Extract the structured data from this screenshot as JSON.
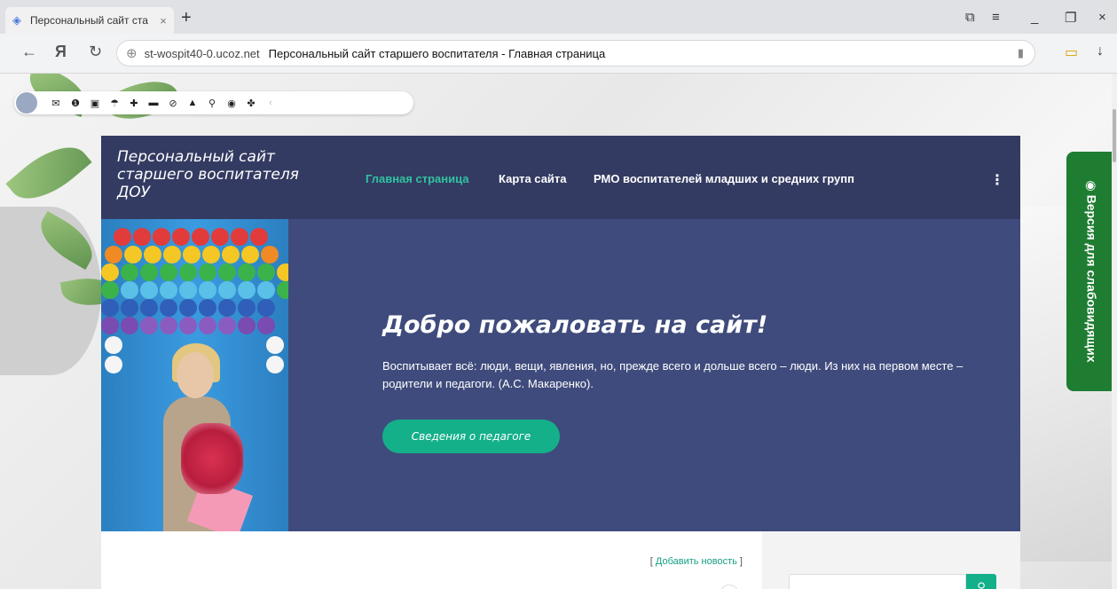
{
  "browser": {
    "tab_title": "Персональный сайт ста",
    "tab_close": "×",
    "new_tab": "+",
    "url_host": "st-wospit40-0.ucoz.net",
    "page_title": "Персональный сайт старшего воспитателя - Главная страница",
    "icons": {
      "favicon": "◈",
      "back": "←",
      "yandex": "Я",
      "reload": "↻",
      "globe": "⊕",
      "bookmark": "▮",
      "battery": "▭",
      "download": "↓",
      "tabs_list": "⧉",
      "menu": "≡",
      "minimize": "_",
      "restore": "❐",
      "close": "×"
    }
  },
  "ucoz_bar": {
    "icons": [
      "✉",
      "❶",
      "▣",
      "☂",
      "✚",
      "▬",
      "⊘",
      "▲",
      "⚲",
      "◉",
      "✤",
      "‹"
    ]
  },
  "site": {
    "logo": "Персональный сайт старшего воспитателя ДОУ",
    "menu": {
      "home": "Главная страница",
      "sitemap": "Карта сайта",
      "rmo": "РМО воспитателей младших и средних групп",
      "more": "⋮"
    },
    "hero": {
      "title": "Добро пожаловать на сайт!",
      "quote": "Воспитывает всё: люди, вещи, явления, но, прежде всего и дольше всего – люди. Из них на первом месте – родители и педагоги. (А.С. Макаренко).",
      "button": "Сведения о педагоге"
    },
    "content": {
      "add_news_open": "[ ",
      "add_news": "Добавить новость",
      "add_news_close": " ]"
    },
    "search_icon": "⚲"
  },
  "accessibility": {
    "label": "Версия для слабовидящих",
    "icon": "◉"
  },
  "colors": {
    "header_bg": "#343b62",
    "hero_bg": "#3f4b7c",
    "accent": "#14b08a",
    "vision_bg": "#1f7d32"
  }
}
